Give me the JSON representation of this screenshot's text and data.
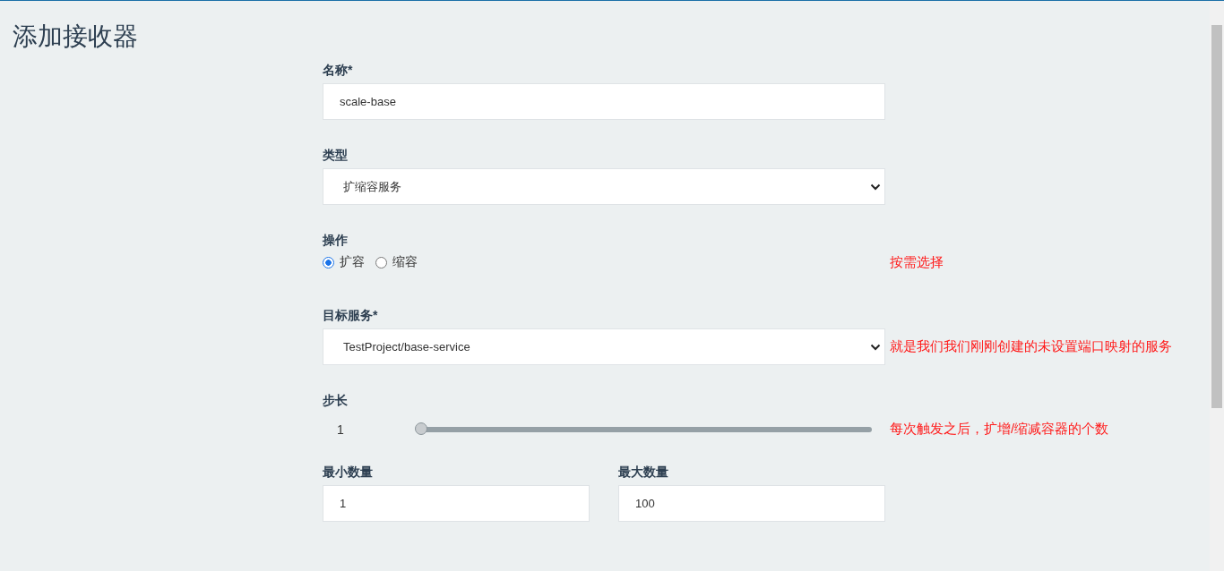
{
  "page": {
    "title": "添加接收器"
  },
  "fields": [
    {
      "kind": "text",
      "label": "名称*",
      "value": "scale-base"
    },
    {
      "kind": "select",
      "label": "类型",
      "value": "扩缩容服务"
    },
    {
      "kind": "radio",
      "label": "操作",
      "options": [
        {
          "label": "扩容",
          "selected": true
        },
        {
          "label": "缩容",
          "selected": false
        }
      ],
      "note": "按需选择"
    },
    {
      "kind": "select",
      "label": "目标服务*",
      "value": "TestProject/base-service",
      "note": "就是我们我们刚刚创建的未设置端口映射的服务"
    },
    {
      "kind": "slider",
      "label": "步长",
      "reading": "1",
      "level": 0,
      "note": "每次触发之后，扩增/缩减容器的个数"
    },
    {
      "kind": "pair",
      "items": [
        {
          "label": "最小数量",
          "value": "1"
        },
        {
          "label": "最大数量",
          "value": "100"
        }
      ]
    }
  ]
}
